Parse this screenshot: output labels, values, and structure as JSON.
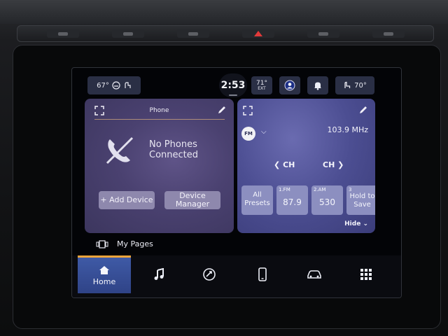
{
  "status": {
    "climate_left": {
      "temp": "67°"
    },
    "clock": "2:53",
    "outside": {
      "temp": "71°",
      "label": "EXT"
    },
    "climate_right": {
      "temp": "70°"
    }
  },
  "phone_card": {
    "title": "Phone",
    "message_line1": "No Phones",
    "message_line2": "Connected",
    "add_device": "+ Add Device",
    "device_manager_line1": "Device",
    "device_manager_line2": "Manager"
  },
  "radio_card": {
    "band": "FM",
    "frequency": "103.9 MHz",
    "ch_prev": "CH",
    "ch_next": "CH",
    "all_presets_line1": "All",
    "all_presets_line2": "Presets",
    "presets": [
      {
        "number": "1.FM",
        "value": "87.9"
      },
      {
        "number": "2.AM",
        "value": "530"
      }
    ],
    "hold_slot": {
      "number": "3",
      "line1": "Hold to",
      "line2": "Save"
    },
    "hide": "Hide"
  },
  "my_pages": "My Pages",
  "nav": {
    "home": "Home",
    "items": [
      "music-icon",
      "navigation-icon",
      "phone-icon",
      "vehicle-icon",
      "apps-grid-icon"
    ]
  },
  "colors": {
    "home_accent": "#f0a53a",
    "card_phone": "#4a4170",
    "card_radio": "#4c4e92"
  }
}
